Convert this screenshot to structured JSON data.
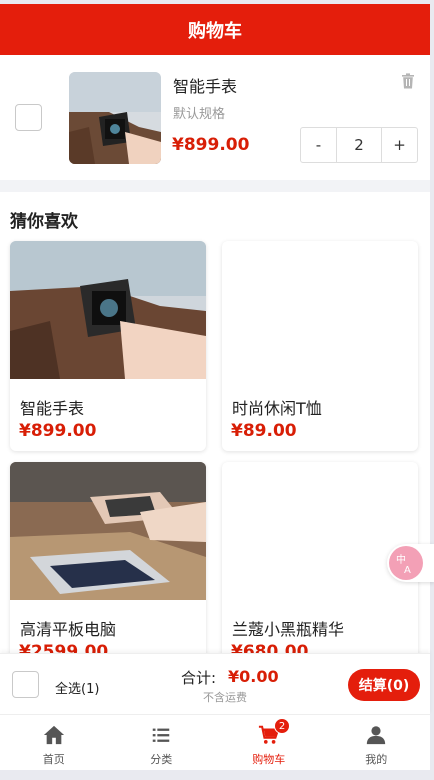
{
  "header": {
    "title": "购物车"
  },
  "cart": {
    "items": [
      {
        "name": "智能手表",
        "spec": "默认规格",
        "price": "¥899.00",
        "quantity": "2",
        "minus": "-",
        "plus": "+"
      }
    ]
  },
  "recommend": {
    "title": "猜你喜欢",
    "products": [
      {
        "name": "智能手表",
        "price": "¥899.00"
      },
      {
        "name": "时尚休闲T恤",
        "price": "¥89.00"
      },
      {
        "name": "高清平板电脑",
        "price": "¥2599.00"
      },
      {
        "name": "兰蔻小黑瓶精华",
        "price": "¥680.00"
      }
    ]
  },
  "checkout": {
    "select_all": "全选(1)",
    "total_label": "合计:",
    "total_value": "¥0.00",
    "shipping_note": "不含运费",
    "pay_button": "结算(0)"
  },
  "tabbar": {
    "items": [
      {
        "label": "首页",
        "icon": "home-icon"
      },
      {
        "label": "分类",
        "icon": "list-icon"
      },
      {
        "label": "购物车",
        "icon": "cart-icon",
        "active": true,
        "badge": "2"
      },
      {
        "label": "我的",
        "icon": "user-icon"
      }
    ]
  },
  "colors": {
    "brand": "#e41e0c",
    "price": "#d81e06"
  }
}
